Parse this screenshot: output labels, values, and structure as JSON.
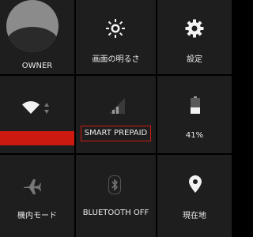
{
  "tiles": {
    "owner": {
      "label": "OWNER",
      "icon": "user-avatar-icon"
    },
    "brightness": {
      "label": "画面の明るさ",
      "icon": "brightness-sun-icon"
    },
    "settings": {
      "label": "設定",
      "icon": "gear-icon"
    },
    "wifi": {
      "label": "",
      "icon": "wifi-icon"
    },
    "mobile": {
      "label": "SMART PREPAID",
      "icon": "signal-bars-icon"
    },
    "battery": {
      "label": "41%",
      "icon": "battery-icon",
      "level": 0.41
    },
    "airplane": {
      "label": "機内モード",
      "icon": "airplane-icon"
    },
    "bluetooth": {
      "label": "BLUETOOTH OFF",
      "icon": "bluetooth-icon"
    },
    "location": {
      "label": "現在地",
      "icon": "location-pin-icon"
    }
  },
  "colors": {
    "accent_red": "#cc1a10",
    "tile_bg": "#1e1e1e",
    "background": "#000000"
  }
}
